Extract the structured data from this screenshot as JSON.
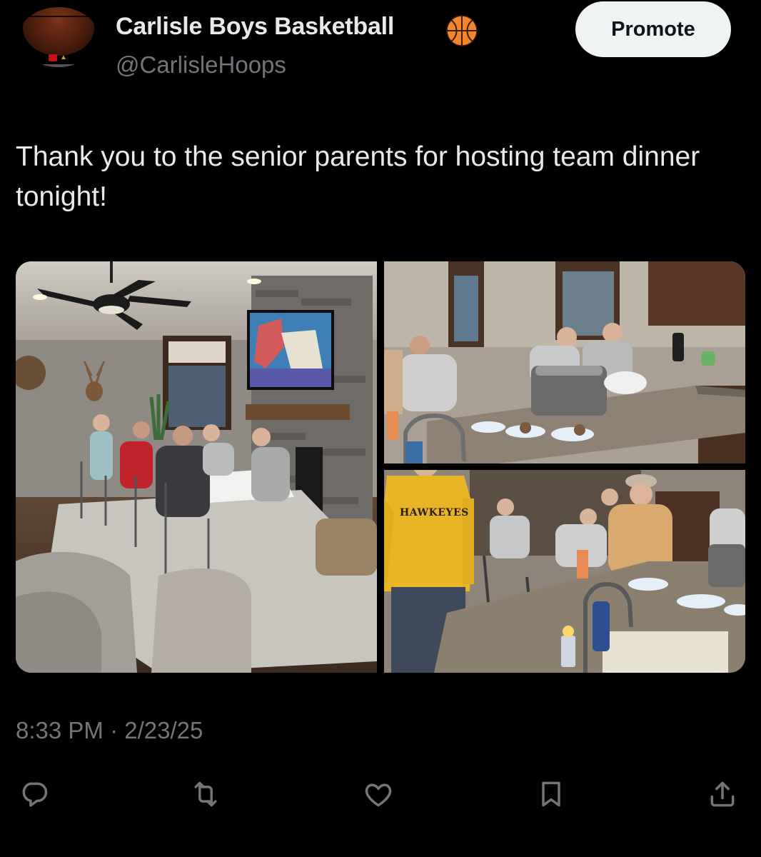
{
  "author": {
    "display_name": "Carlisle Boys Basketball",
    "handle": "@CarlisleHoops",
    "badge_icon": "basketball-emoji-icon",
    "avatar_icon": "basketball-avatar-icon"
  },
  "header": {
    "promote_label": "Promote"
  },
  "tweet": {
    "text": "Thank you to the senior parents for hosting team dinner tonight!",
    "timestamp": "8:33 PM · 2/23/25"
  },
  "media": {
    "photos": [
      {
        "scene": "living-room-team-dinner"
      },
      {
        "scene": "kitchen-island-dinner"
      },
      {
        "scene": "kitchen-counter-parents"
      }
    ],
    "shirt_text": "HAWKEYES"
  },
  "actions": [
    {
      "icon": "reply-icon"
    },
    {
      "icon": "repost-icon"
    },
    {
      "icon": "like-icon"
    },
    {
      "icon": "bookmark-icon"
    },
    {
      "icon": "share-icon"
    }
  ],
  "colors": {
    "background": "#000000",
    "primary_text": "#e7e9ea",
    "secondary_text": "#71767b",
    "promote_bg": "#eff3f4",
    "promote_text": "#0f1419"
  }
}
